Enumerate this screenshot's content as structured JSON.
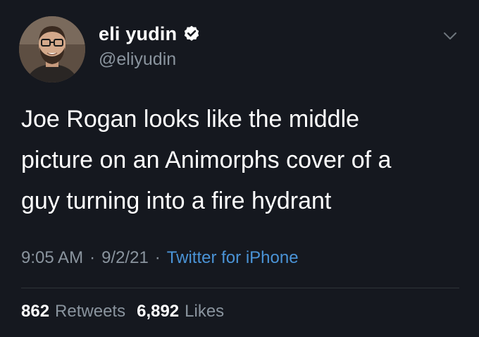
{
  "author": {
    "display_name": "eli yudin",
    "handle": "@eliyudin",
    "verified": true,
    "avatar_icon": "avatar-photo",
    "verified_icon": "verified-badge-icon"
  },
  "menu_icon": "chevron-down-icon",
  "tweet": {
    "lines": [
      "Joe Rogan looks like the middle",
      "picture on an Animorphs cover of a",
      "guy turning into a fire hydrant"
    ]
  },
  "meta": {
    "time": "9:05 AM",
    "date": "9/2/21",
    "separator": "·",
    "source": "Twitter for iPhone"
  },
  "stats": {
    "retweets_count": "862",
    "retweets_label": "Retweets",
    "likes_count": "6,892",
    "likes_label": "Likes"
  },
  "colors": {
    "background": "#15181f",
    "text_primary": "#ffffff",
    "text_secondary": "#8a949e",
    "link": "#4a93d6"
  }
}
